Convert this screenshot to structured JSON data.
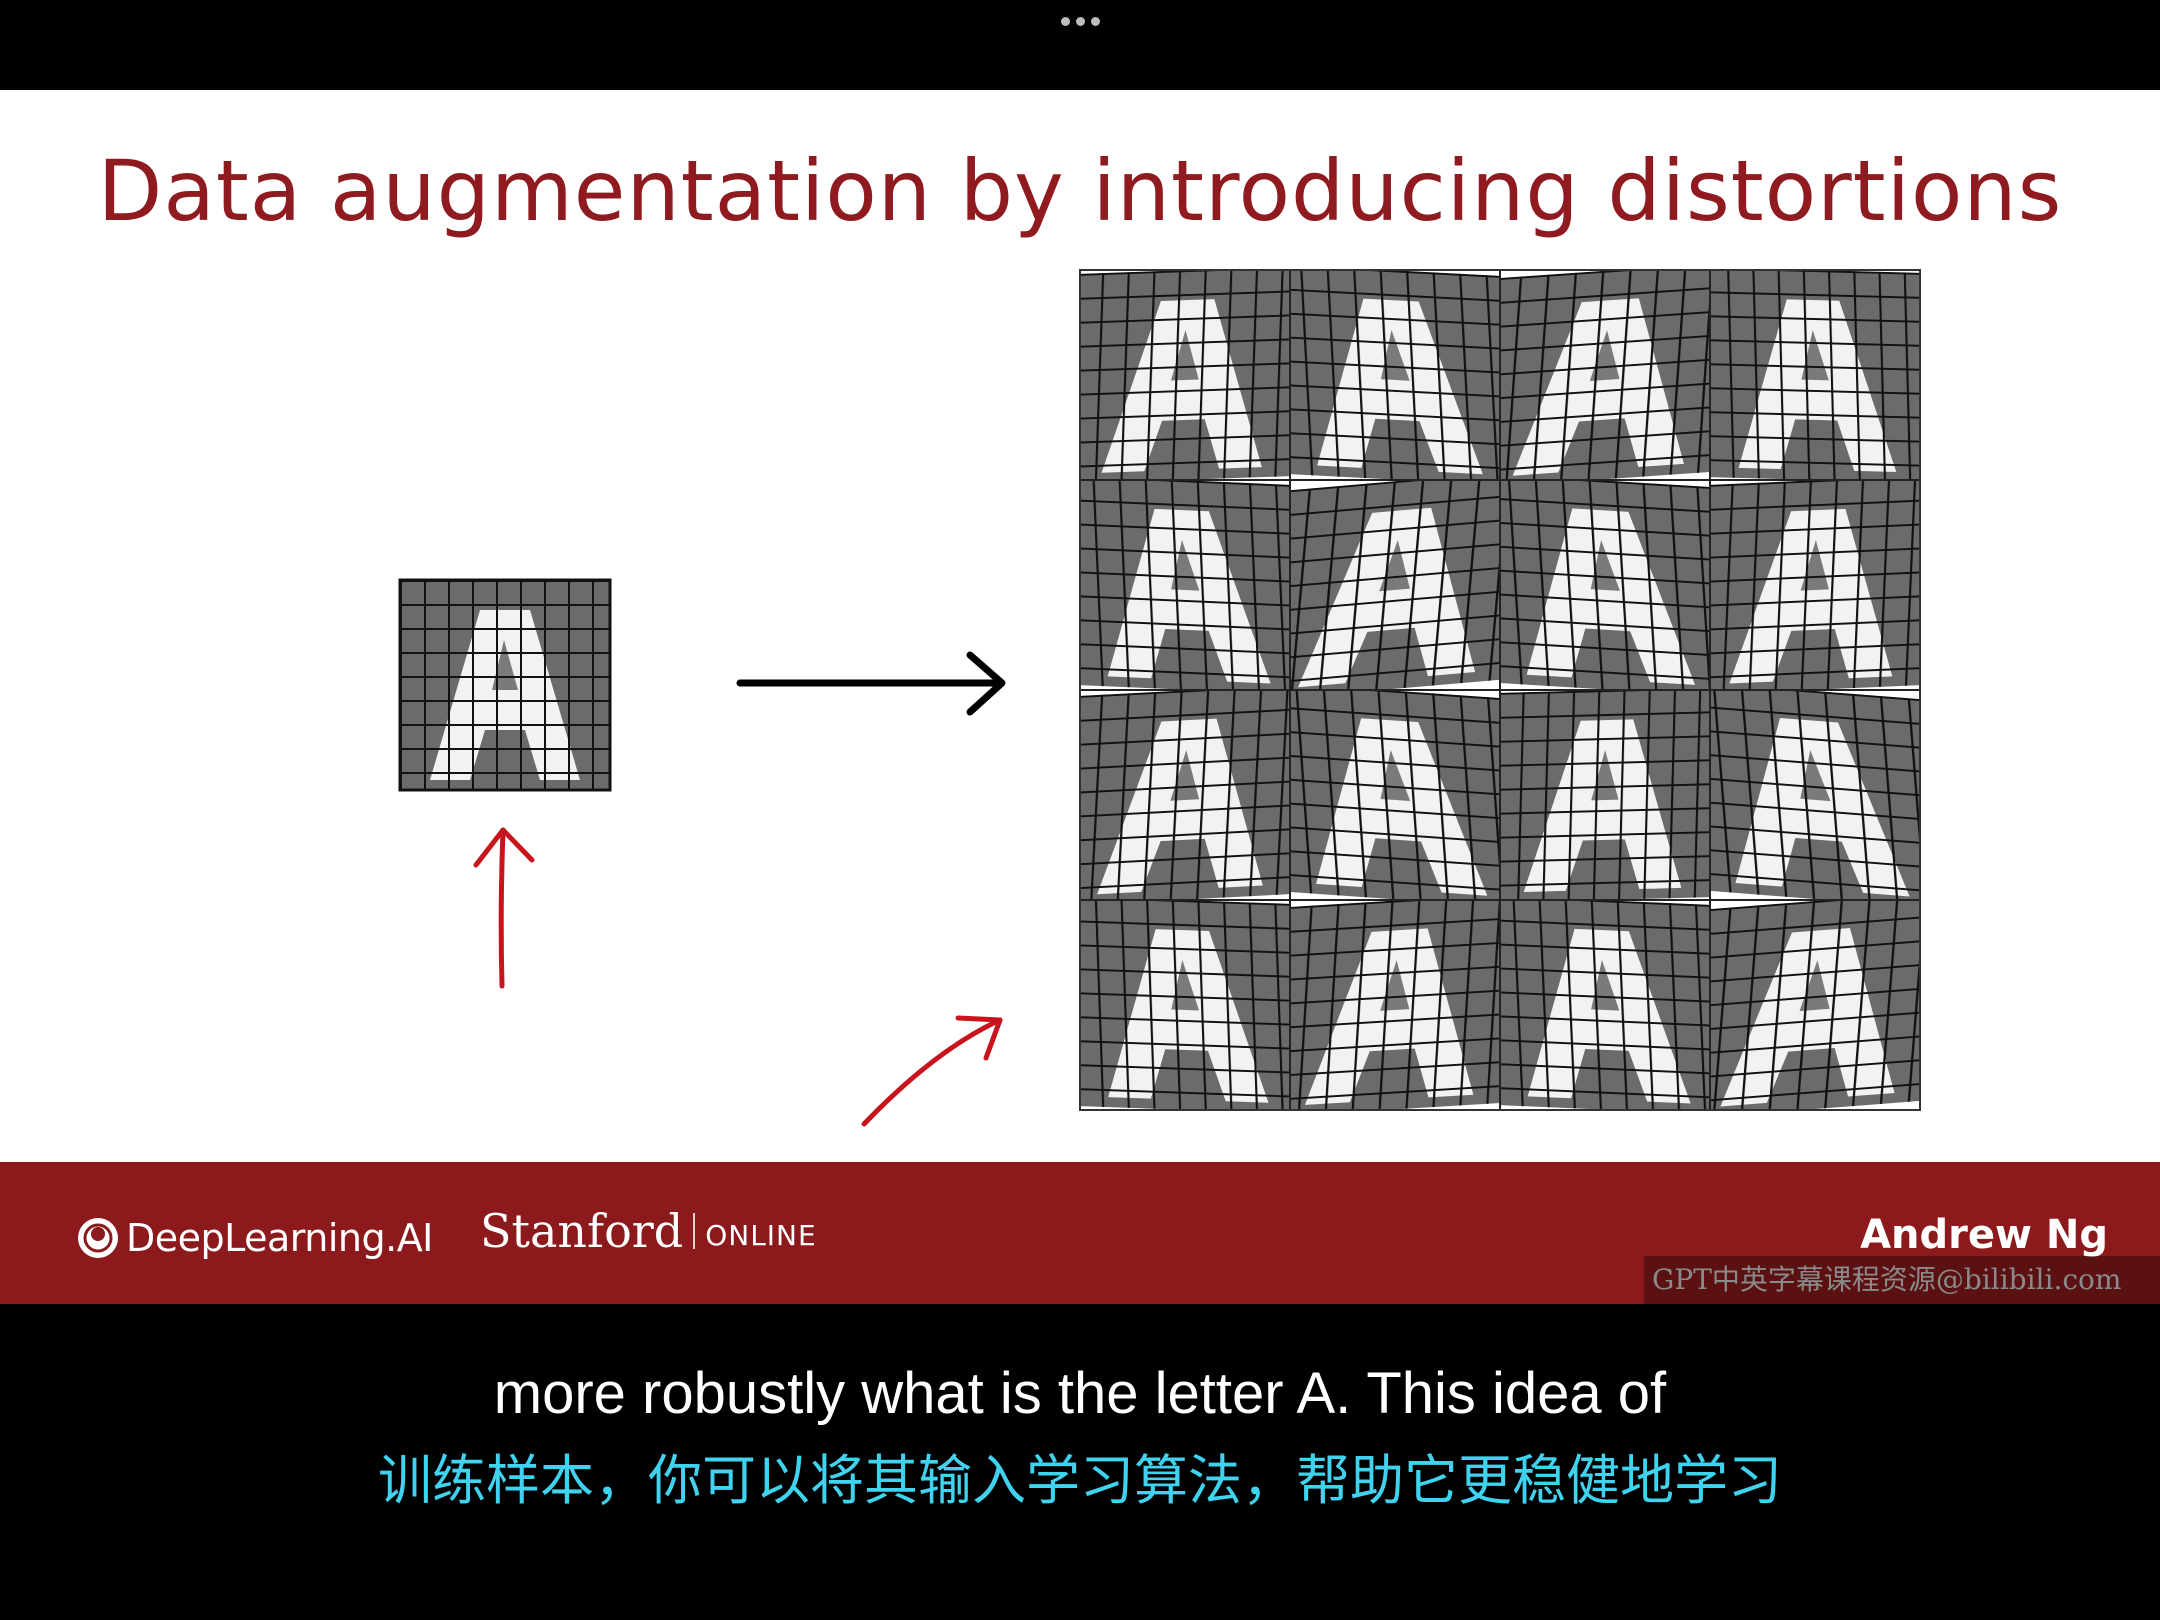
{
  "window": {
    "more_icon": "more-horizontal-icon"
  },
  "slide": {
    "title": "Data augmentation by introducing distortions",
    "original_label": "letter-A-grid-image",
    "distortion_grid": {
      "rows": 4,
      "cols": 4
    }
  },
  "footer": {
    "brand1": "DeepLearning.AI",
    "brand2_word": "Stanford",
    "brand2_suffix": "ONLINE",
    "presenter": "Andrew Ng"
  },
  "watermark": "GPT中英字幕课程资源@bilibili.com",
  "subtitles": {
    "english": "more robustly what is the letter A. This idea of",
    "chinese": "训练样本，你可以将其输入学习算法，帮助它更稳健地学习"
  },
  "colors": {
    "title": "#8f1a1f",
    "footer": "#8c1a1c",
    "subtitle_zh": "#3fd3f0",
    "annotation": "#c8141c"
  }
}
